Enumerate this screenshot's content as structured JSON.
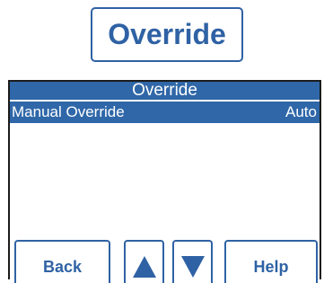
{
  "header_button": {
    "label": "Override"
  },
  "screen": {
    "title": "Override",
    "rows": [
      {
        "label": "Manual Override",
        "value": "Auto",
        "selected": true
      }
    ]
  },
  "softkeys": {
    "back": "Back",
    "up_icon": "up-arrow",
    "down_icon": "down-arrow",
    "help": "Help"
  },
  "colors": {
    "accent": "#2f67a8",
    "border_blue": "#2f62a4",
    "text_on_accent": "#ffffff"
  }
}
